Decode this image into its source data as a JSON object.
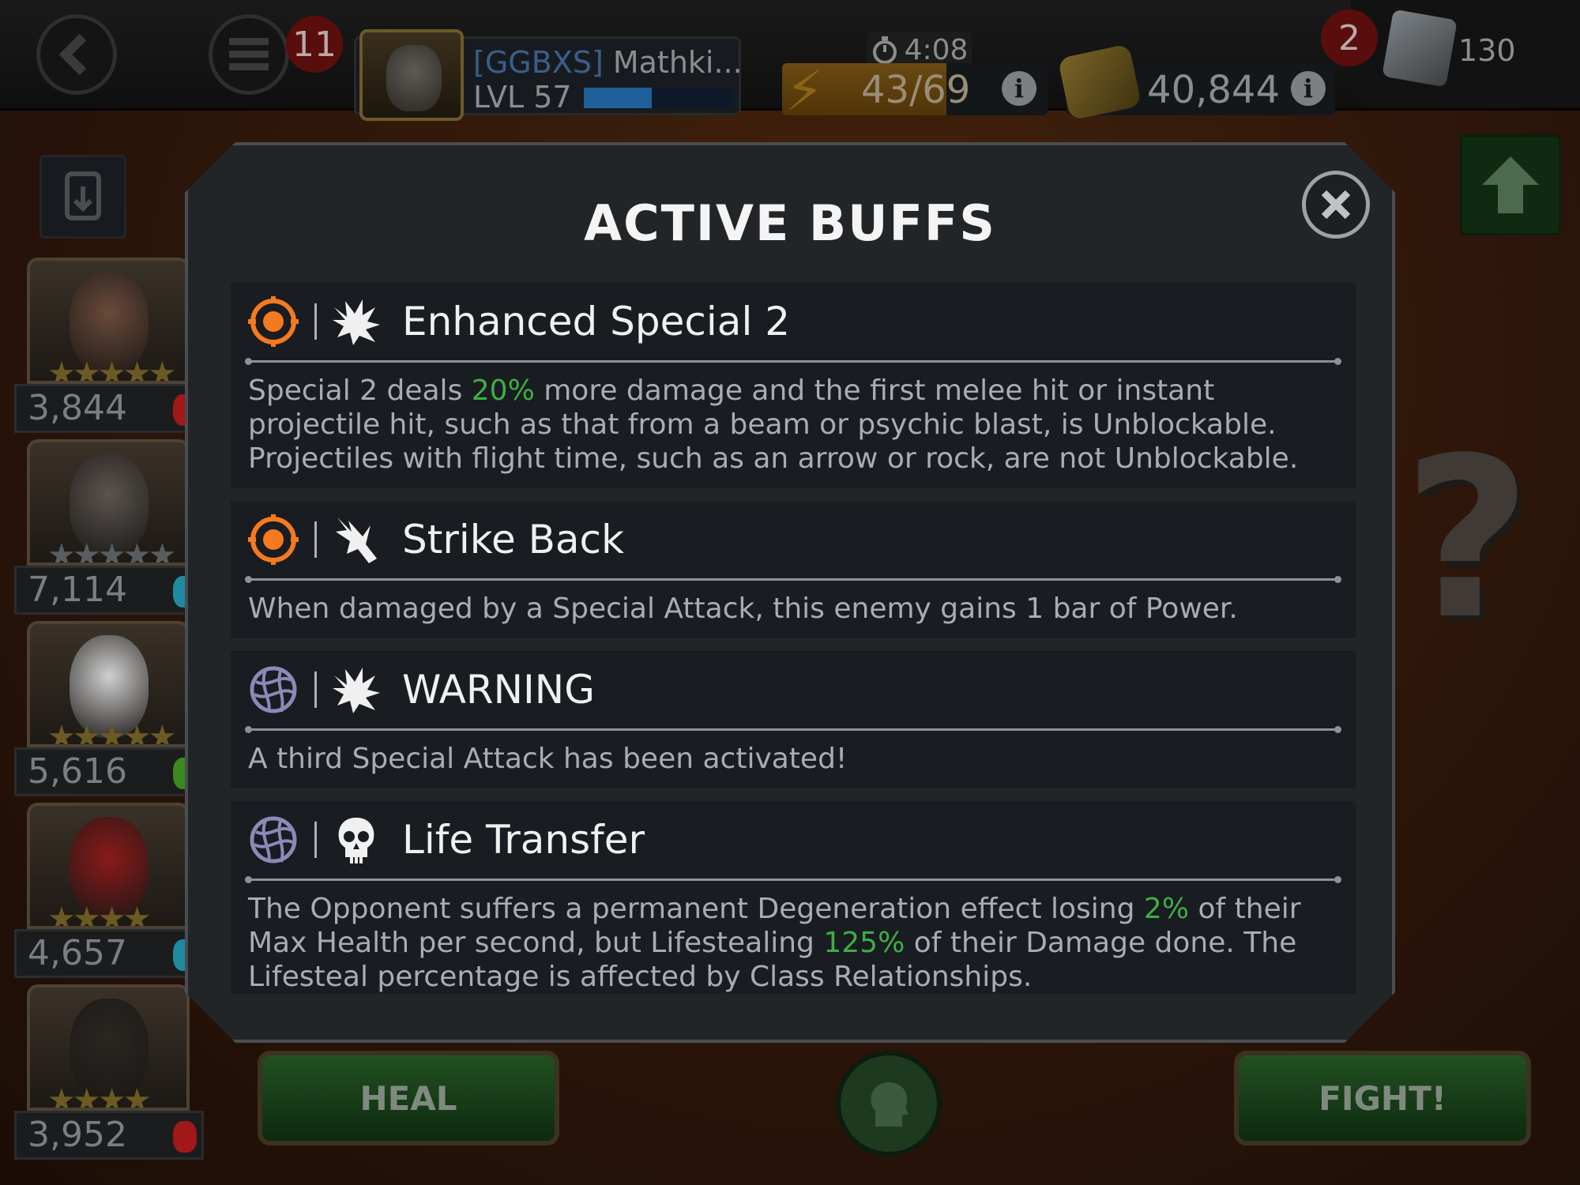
{
  "topbar": {
    "notifications_count": "11",
    "profile": {
      "alliance_tag": "[GGBXS]",
      "name": "Mathki...",
      "level": "LVL 57",
      "xp_fraction": 0.45
    },
    "timer": "4:08",
    "energy": {
      "value": "43/69",
      "fraction": 0.62
    },
    "gold": "40,844",
    "units_badge": "2",
    "units": "130"
  },
  "roster": [
    {
      "rating": "3,844",
      "stars": "★★★★★",
      "star_color": "gold",
      "face": "#6a4a3a",
      "class_color": "#a01818"
    },
    {
      "rating": "7,114",
      "stars": "★★★★★",
      "star_color": "silver",
      "face": "#5a5450",
      "class_color": "#1e8aa0"
    },
    {
      "rating": "5,616",
      "stars": "★★★★★",
      "star_color": "gold",
      "face": "#d0d0d0",
      "class_color": "#3a8a1e"
    },
    {
      "rating": "4,657",
      "stars": "★★★★",
      "star_color": "gold",
      "face": "#8a1a1a",
      "class_color": "#1e8aa0"
    },
    {
      "rating": "3,952",
      "stars": "★★★★",
      "star_color": "gold",
      "face": "#2a2622",
      "class_color": "#a01818"
    }
  ],
  "modal": {
    "title": "ACTIVE BUFFS",
    "buffs": [
      {
        "name": "Enhanced Special 2",
        "source_icon": "target-icon",
        "type_icon": "burst-icon",
        "desc": [
          {
            "t": "Special 2 deals "
          },
          {
            "t": "20%",
            "hl": true
          },
          {
            "t": " more damage and the first melee hit or instant projectile hit, such as that from a beam or psychic blast, is Unblockable. Projectiles with flight time, such as an arrow or rock, are not Unblockable."
          }
        ]
      },
      {
        "name": "Strike Back",
        "source_icon": "target-icon",
        "type_icon": "strike-icon",
        "desc": [
          {
            "t": "When damaged by a Special Attack, this enemy gains 1 bar of Power."
          }
        ]
      },
      {
        "name": "WARNING",
        "source_icon": "globe-icon",
        "type_icon": "burst-icon",
        "desc": [
          {
            "t": "A third Special Attack has been activated!"
          }
        ]
      },
      {
        "name": "Life Transfer",
        "source_icon": "globe-icon",
        "type_icon": "skull-icon",
        "desc": [
          {
            "t": "The Opponent suffers a permanent Degeneration effect losing "
          },
          {
            "t": "2%",
            "hl": true
          },
          {
            "t": " of their Max Health per second, but Lifestealing "
          },
          {
            "t": "125%",
            "hl": true
          },
          {
            "t": " of their Damage done. The Lifesteal percentage is affected by Class Relationships."
          }
        ]
      }
    ]
  },
  "bottom": {
    "heal_label": "HEAL",
    "fight_label": "FIGHT!"
  },
  "colors": {
    "accent_orange": "#f47a1f",
    "highlight_green": "#3fae45",
    "globe_purple": "#8c89b8"
  }
}
